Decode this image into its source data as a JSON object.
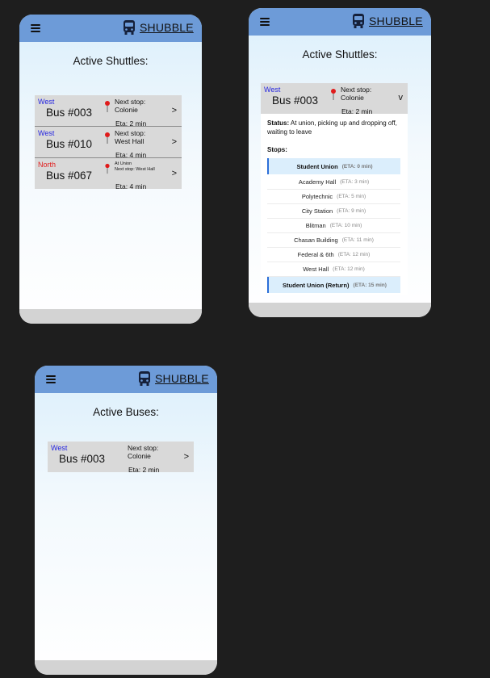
{
  "brand": {
    "name": "SHUBBLE"
  },
  "icons": {
    "menu": "hamburger-menu-icon",
    "bus": "bus-icon",
    "pin": "map-pin-icon",
    "chevron_right": ">",
    "chevron_down": "v"
  },
  "colors": {
    "header": "#6d9bd8",
    "direction_west": "#2626e0",
    "direction_north": "#e02020",
    "card": "#d9d9d9",
    "highlight": "#dbeefc",
    "highlight_border": "#2c6fd8"
  },
  "screen1": {
    "title": "Active Shuttles:",
    "buses": [
      {
        "direction": "West",
        "number": "Bus #003",
        "next_label": "Next stop:",
        "next_stop": "Colonie",
        "eta": "Eta: 2 min"
      },
      {
        "direction": "West",
        "number": "Bus #010",
        "next_label": "Next stop:",
        "next_stop": "West Hall",
        "eta": "Eta: 4 min"
      },
      {
        "direction": "North",
        "number": "Bus #067",
        "next_label": "At Union",
        "next_stop": "Next stop: West Hall",
        "eta": "Eta: 4 min"
      }
    ]
  },
  "screen2": {
    "title": "Active Shuttles:",
    "bus": {
      "direction": "West",
      "number": "Bus #003",
      "next_label": "Next stop:",
      "next_stop": "Colonie",
      "eta": "Eta: 2 min"
    },
    "status_label": "Status:",
    "status_text": "At union, picking up and dropping off, waiting to leave",
    "stops_label": "Stops:",
    "stops": [
      {
        "name": "Student Union",
        "eta": "(ETA: 0 min)"
      },
      {
        "name": "Academy Hall",
        "eta": "(ETA: 3 min)"
      },
      {
        "name": "Polytechnic",
        "eta": "(ETA: 5 min)"
      },
      {
        "name": "City Station",
        "eta": "(ETA: 9 min)"
      },
      {
        "name": "Blitman",
        "eta": "(ETA: 10 min)"
      },
      {
        "name": "Chasan Building",
        "eta": "(ETA: 11 min)"
      },
      {
        "name": "Federal & 6th",
        "eta": "(ETA: 12 min)"
      },
      {
        "name": "West Hall",
        "eta": "(ETA: 12 min)"
      },
      {
        "name": "Student Union (Return)",
        "eta": "(ETA: 15 min)"
      }
    ]
  },
  "screen3": {
    "title": "Active Buses:",
    "bus": {
      "direction": "West",
      "number": "Bus #003",
      "next_label": "Next stop:",
      "next_stop": "Colonie",
      "eta": "Eta: 2 min"
    }
  }
}
